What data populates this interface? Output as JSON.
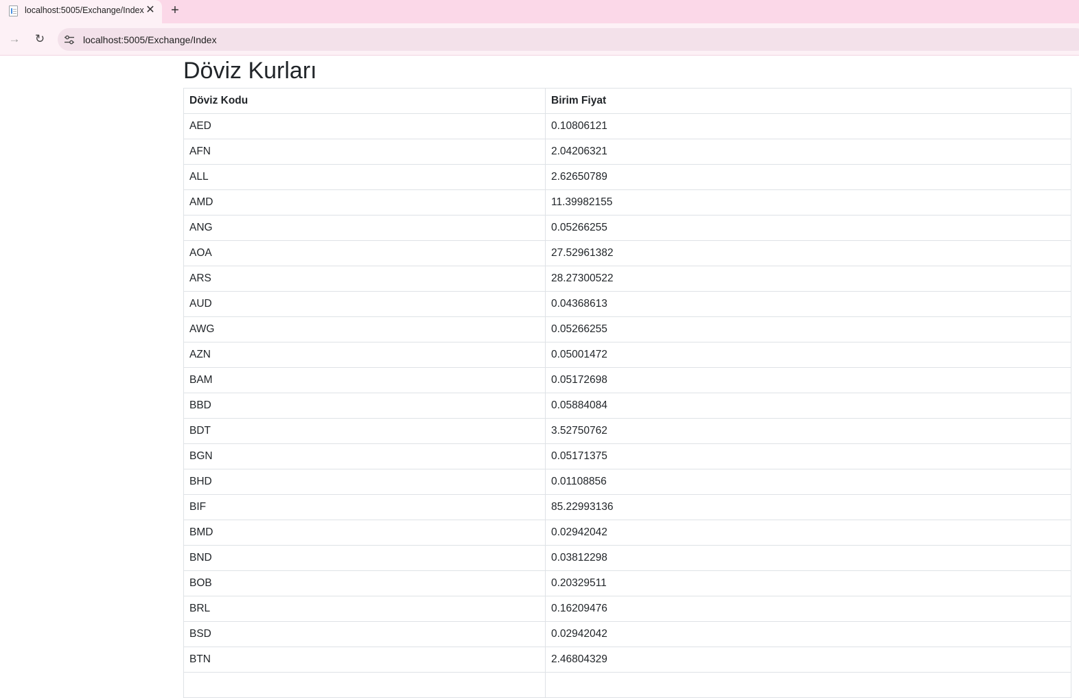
{
  "browser": {
    "tab_title": "localhost:5005/Exchange/Index",
    "close_glyph": "✕",
    "new_tab_glyph": "+",
    "forward_glyph": "→",
    "reload_glyph": "↻",
    "url": "localhost:5005/Exchange/Index",
    "icons": [
      "page-favicon-icon",
      "close-icon",
      "plus-icon",
      "forward-arrow-icon",
      "reload-icon",
      "site-info-icon"
    ]
  },
  "page": {
    "title": "Döviz Kurları",
    "table": {
      "headers": [
        "Döviz Kodu",
        "Birim Fiyat"
      ],
      "rows": [
        [
          "AED",
          "0.10806121"
        ],
        [
          "AFN",
          "2.04206321"
        ],
        [
          "ALL",
          "2.62650789"
        ],
        [
          "AMD",
          "11.39982155"
        ],
        [
          "ANG",
          "0.05266255"
        ],
        [
          "AOA",
          "27.52961382"
        ],
        [
          "ARS",
          "28.27300522"
        ],
        [
          "AUD",
          "0.04368613"
        ],
        [
          "AWG",
          "0.05266255"
        ],
        [
          "AZN",
          "0.05001472"
        ],
        [
          "BAM",
          "0.05172698"
        ],
        [
          "BBD",
          "0.05884084"
        ],
        [
          "BDT",
          "3.52750762"
        ],
        [
          "BGN",
          "0.05171375"
        ],
        [
          "BHD",
          "0.01108856"
        ],
        [
          "BIF",
          "85.22993136"
        ],
        [
          "BMD",
          "0.02942042"
        ],
        [
          "BND",
          "0.03812298"
        ],
        [
          "BOB",
          "0.20329511"
        ],
        [
          "BRL",
          "0.16209476"
        ],
        [
          "BSD",
          "0.02942042"
        ],
        [
          "BTN",
          "2.46804329"
        ],
        [
          "",
          ""
        ]
      ]
    }
  }
}
